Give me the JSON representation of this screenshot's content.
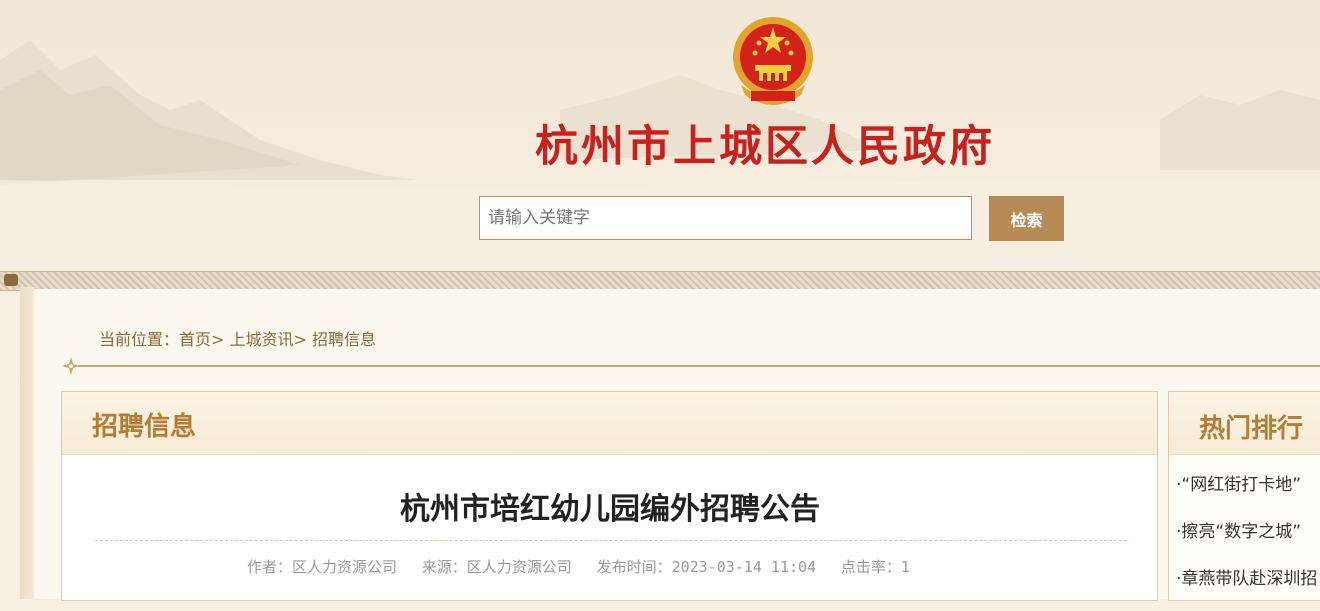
{
  "header": {
    "site_title": "杭州市上城区人民政府",
    "search_placeholder": "请输入关键字",
    "search_button": "检索"
  },
  "breadcrumb": {
    "prefix": "当前位置：",
    "items": [
      "首页",
      "上城资讯",
      "招聘信息"
    ],
    "separator": ">"
  },
  "main": {
    "panel_title": "招聘信息",
    "article_title": "杭州市培红幼儿园编外招聘公告",
    "meta": {
      "author": "作者：区人力资源公司",
      "source": "来源：区人力资源公司",
      "published": "发布时间：2023-03-14 11:04",
      "clicks": "点击率：1"
    }
  },
  "sidebar": {
    "title": "热门排行",
    "items": [
      "·“网红街打卡地”",
      "·擦亮“数字之城”",
      "·章燕带队赴深圳招"
    ]
  },
  "colors": {
    "title_red": "#c8201c",
    "accent_gold": "#b57d31",
    "button_brown": "#b88a55"
  },
  "icons": [
    "national-emblem-icon",
    "ornament-divider-icon"
  ]
}
